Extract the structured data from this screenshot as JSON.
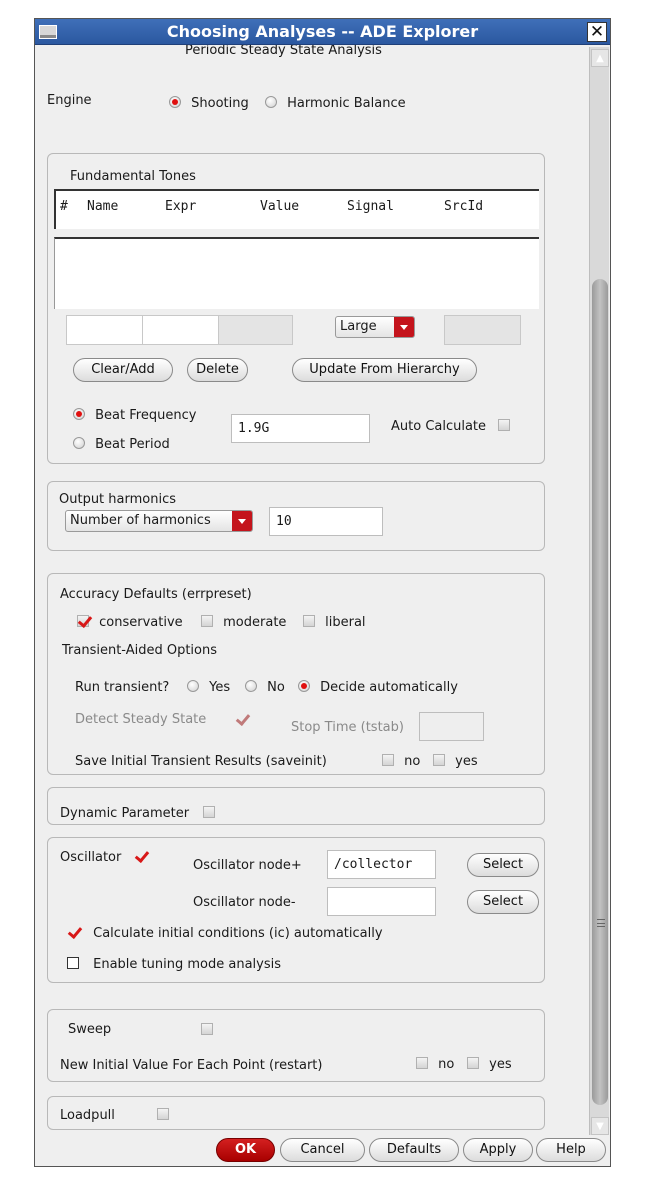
{
  "window": {
    "title": "Choosing Analyses -- ADE Explorer",
    "section_header": "Periodic Steady State Analysis"
  },
  "engine": {
    "label": "Engine",
    "options": [
      "Shooting",
      "Harmonic Balance"
    ],
    "selected": "Shooting"
  },
  "fundamental_tones": {
    "label": "Fundamental Tones",
    "columns": [
      "#",
      "Name",
      "Expr",
      "Value",
      "Signal",
      "SrcId"
    ],
    "rows": [],
    "signal_select": "Large",
    "buttons": [
      "Clear/Add",
      "Delete",
      "Update From Hierarchy"
    ],
    "beat_options": [
      "Beat Frequency",
      "Beat Period"
    ],
    "beat_selected": "Beat Frequency",
    "beat_value": "1.9G",
    "auto_calculate_label": "Auto Calculate"
  },
  "output_harmonics": {
    "label": "Output harmonics",
    "mode": "Number of harmonics",
    "value": "10"
  },
  "accuracy": {
    "label": "Accuracy Defaults (errpreset)",
    "options": [
      "conservative",
      "moderate",
      "liberal"
    ],
    "selected": "conservative",
    "transient_label": "Transient-Aided Options",
    "run_transient_label": "Run transient?",
    "run_transient_options": [
      "Yes",
      "No",
      "Decide automatically"
    ],
    "run_transient_selected": "Decide automatically",
    "detect_steady_state_label": "Detect Steady State",
    "stop_time_label": "Stop Time (tstab)",
    "save_initial_label": "Save Initial Transient Results (saveinit)",
    "save_options": [
      "no",
      "yes"
    ]
  },
  "dynamic_parameter": {
    "label": "Dynamic Parameter"
  },
  "oscillator": {
    "label": "Oscillator",
    "node_plus_label": "Oscillator node+",
    "node_plus_value": "/collector",
    "node_minus_label": "Oscillator node-",
    "node_minus_value": "",
    "select_label": "Select",
    "calc_ic_label": "Calculate initial conditions (ic) automatically",
    "tuning_label": "Enable tuning mode analysis"
  },
  "sweep": {
    "label": "Sweep",
    "restart_label": "New Initial Value For Each Point (restart)",
    "options": [
      "no",
      "yes"
    ]
  },
  "loadpull": {
    "label": "Loadpull"
  },
  "footer": {
    "ok": "OK",
    "cancel": "Cancel",
    "defaults": "Defaults",
    "apply": "Apply",
    "help": "Help"
  },
  "colors": {
    "accent_red": "#c4141c",
    "titlebar_blue": "#3f6fb9",
    "dialog_bg": "#efefef"
  }
}
